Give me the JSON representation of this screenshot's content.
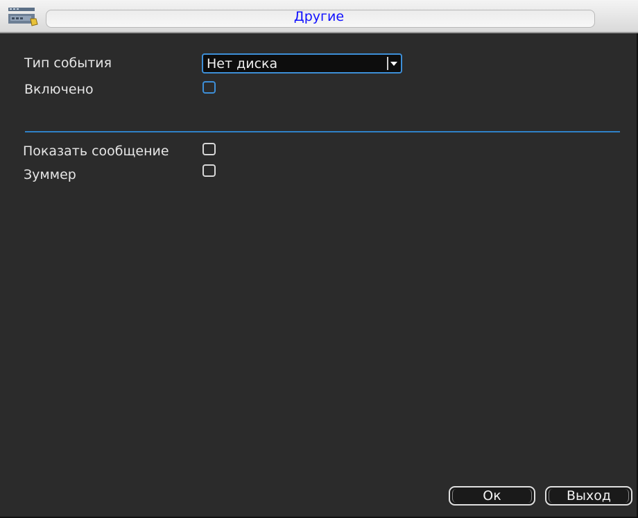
{
  "window": {
    "title": "Другие"
  },
  "form": {
    "event_type_label": "Тип события",
    "event_type_value": "Нет диска",
    "enabled_label": "Включено",
    "enabled_checked": false,
    "show_message_label": "Показать сообщение",
    "show_message_checked": false,
    "buzzer_label": "Зуммер",
    "buzzer_checked": false
  },
  "buttons": {
    "ok_label": "Ок",
    "exit_label": "Выход"
  },
  "colors": {
    "accent": "#3d8fd8",
    "title_text": "#1010ff",
    "background": "#2b2b2b"
  },
  "icons": {
    "title_icon": "settings-panel-icon",
    "dropdown_icon": "chevron-down-icon"
  }
}
